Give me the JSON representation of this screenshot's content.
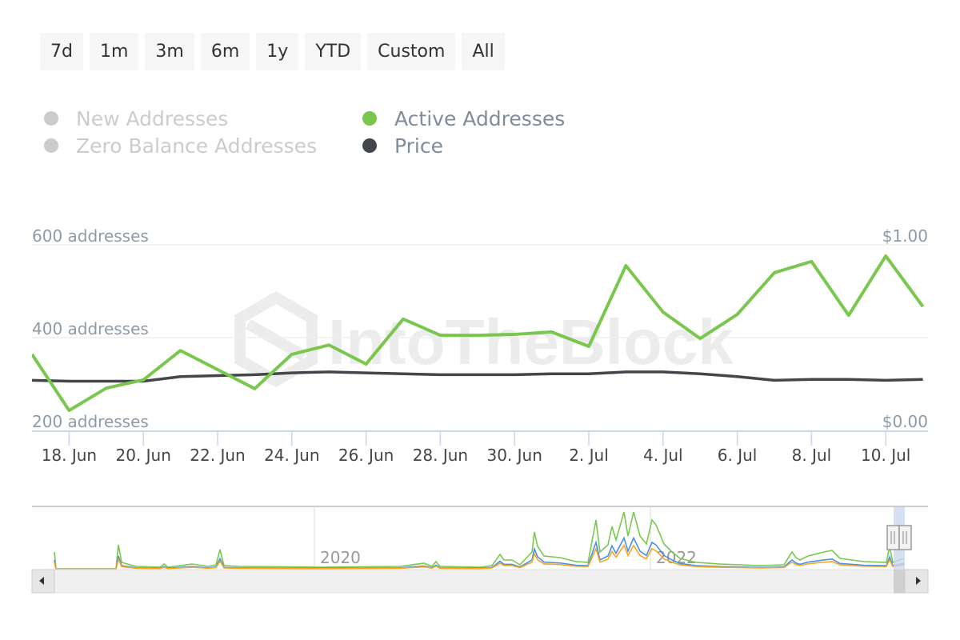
{
  "range_selector": {
    "buttons": [
      "7d",
      "1m",
      "3m",
      "6m",
      "1y",
      "YTD",
      "Custom",
      "All"
    ]
  },
  "legend": [
    {
      "label": "New Addresses",
      "color": "#cccccc",
      "enabled": false
    },
    {
      "label": "Active Addresses",
      "color": "#7ac74f",
      "enabled": true
    },
    {
      "label": "Zero Balance Addresses",
      "color": "#cccccc",
      "enabled": false
    },
    {
      "label": "Price",
      "color": "#43474c",
      "enabled": true
    }
  ],
  "watermark": "IntoTheBlock",
  "chart_data": {
    "type": "line",
    "title": "",
    "x": [
      "17. Jun",
      "18. Jun",
      "19. Jun",
      "20. Jun",
      "21. Jun",
      "22. Jun",
      "23. Jun",
      "24. Jun",
      "25. Jun",
      "26. Jun",
      "27. Jun",
      "28. Jun",
      "29. Jun",
      "30. Jun",
      "1. Jul",
      "2. Jul",
      "3. Jul",
      "4. Jul",
      "5. Jul",
      "6. Jul",
      "7. Jul",
      "8. Jul",
      "9. Jul",
      "10. Jul",
      "11. Jul"
    ],
    "x_tick_labels": [
      "18. Jun",
      "20. Jun",
      "22. Jun",
      "24. Jun",
      "26. Jun",
      "28. Jun",
      "30. Jun",
      "2. Jul",
      "4. Jul",
      "6. Jul",
      "8. Jul",
      "10. Jul"
    ],
    "series": [
      {
        "name": "Active Addresses",
        "axis": "left",
        "color": "#7ac74f",
        "values": [
          364,
          243,
          291,
          309,
          372,
          331,
          290,
          364,
          384,
          343,
          440,
          405,
          405,
          407,
          412,
          381,
          555,
          455,
          398,
          450,
          540,
          564,
          448,
          576,
          467
        ]
      },
      {
        "name": "Price",
        "axis": "right",
        "color": "#43474c",
        "values": [
          0.27,
          0.265,
          0.265,
          0.265,
          0.29,
          0.295,
          0.3,
          0.31,
          0.315,
          0.31,
          0.305,
          0.3,
          0.3,
          0.3,
          0.305,
          0.305,
          0.315,
          0.315,
          0.305,
          0.29,
          0.27,
          0.275,
          0.275,
          0.27,
          0.275
        ]
      }
    ],
    "y_left": {
      "ticks": [
        200,
        400,
        600
      ],
      "tick_labels": [
        "200 addresses",
        "400 addresses",
        "600 addresses"
      ],
      "range": [
        200,
        600
      ]
    },
    "y_right": {
      "ticks": [
        0,
        1
      ],
      "tick_labels": [
        "$0.00",
        "$1.00"
      ],
      "range": [
        0,
        1
      ]
    },
    "grid": true,
    "legend_position": "top-left",
    "navigator": {
      "year_labels": [
        "2020",
        "2022"
      ],
      "series_colors": [
        "#7ac74f",
        "#4a90e2",
        "#f5a623"
      ]
    }
  }
}
